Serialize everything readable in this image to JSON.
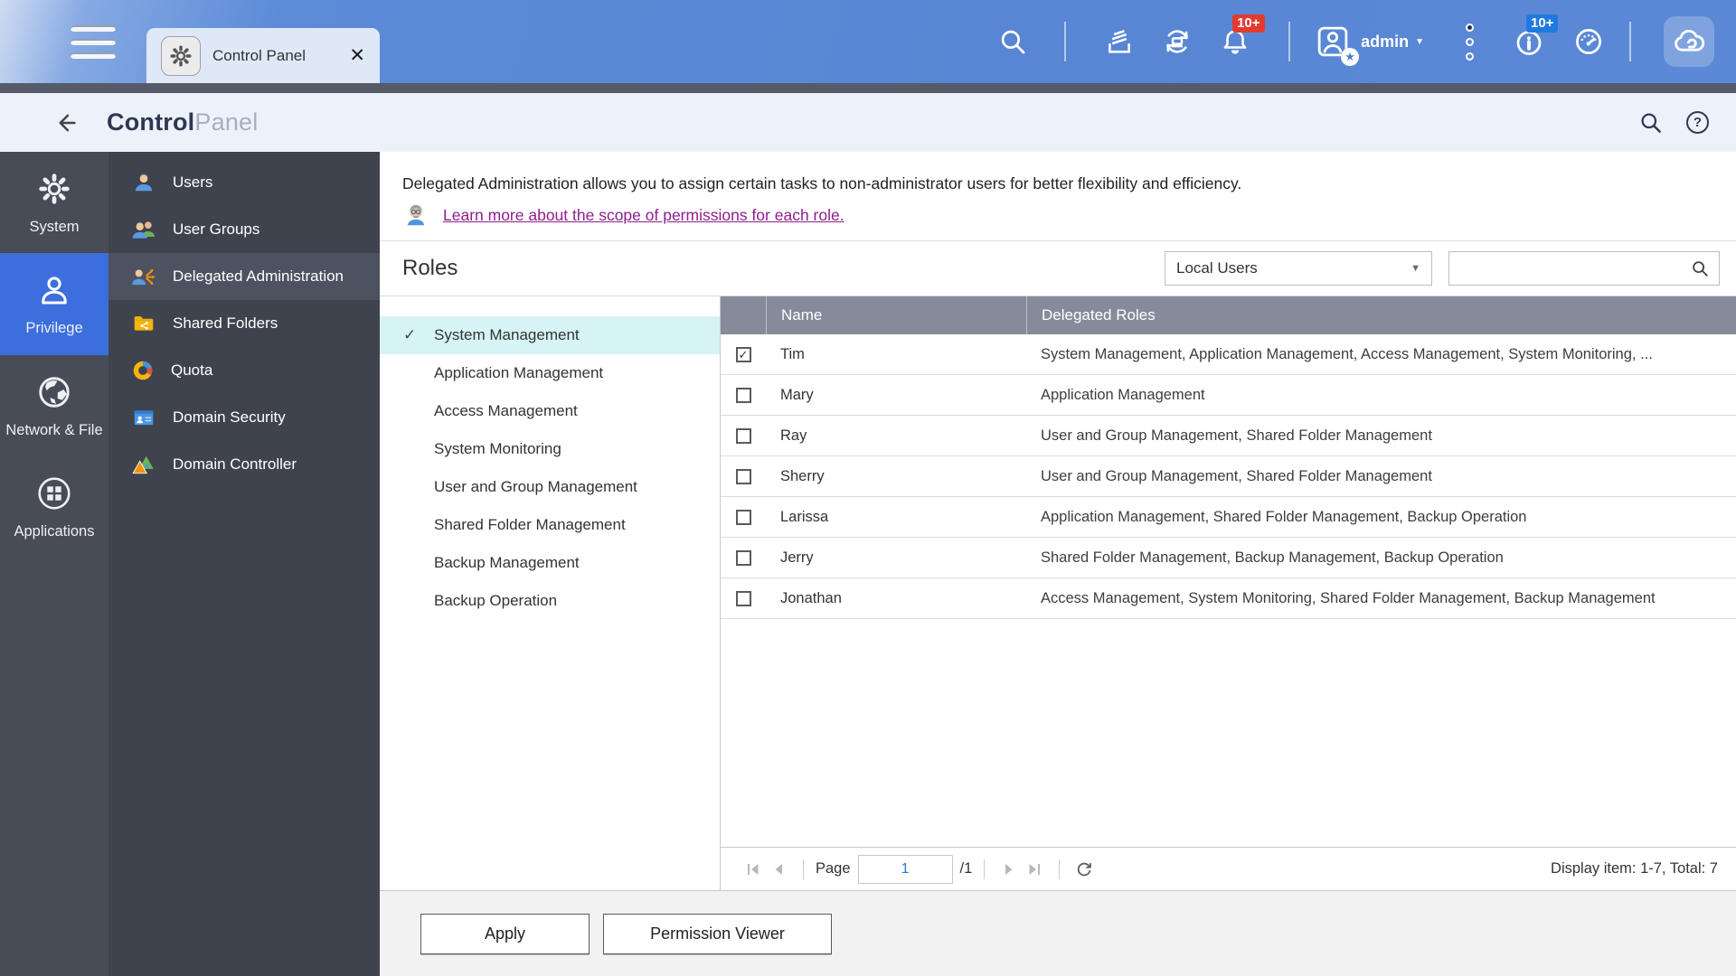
{
  "theme": {
    "accent": "#3c6edd",
    "badge-red": "#e23b2e",
    "badge-blue": "#1f7ae0",
    "link": "#8f1e8f",
    "selection": "#d6f3f5",
    "thead": "#858b9a"
  },
  "topbar": {
    "tab_label": "Control Panel",
    "close_label": "✕",
    "notification_badge": "10+",
    "event_badge": "10+",
    "user_name": "admin"
  },
  "header": {
    "title_bold": "Control",
    "title_light": "Panel",
    "help_glyph": "?"
  },
  "sidebar": {
    "active": "Privilege",
    "items": [
      {
        "label": "System"
      },
      {
        "label": "Privilege"
      },
      {
        "label": "Network & File"
      },
      {
        "label": "Applications"
      }
    ]
  },
  "subsidebar": {
    "active": "Delegated Administration",
    "items": [
      {
        "label": "Users"
      },
      {
        "label": "User Groups"
      },
      {
        "label": "Delegated Administration"
      },
      {
        "label": "Shared Folders"
      },
      {
        "label": "Quota"
      },
      {
        "label": "Domain Security"
      },
      {
        "label": "Domain Controller"
      }
    ]
  },
  "main": {
    "description": "Delegated Administration allows you to assign certain tasks to non-administrator users for better flexibility and efficiency.",
    "learn_more_link": "Learn more about the scope of permissions for each role.",
    "roles_title": "Roles",
    "filter_dropdown": {
      "selected": "Local Users"
    },
    "search": {
      "value": ""
    },
    "roles": {
      "selected": "System Management",
      "items": [
        {
          "label": "System Management",
          "selected": true
        },
        {
          "label": "Application Management",
          "selected": false
        },
        {
          "label": "Access Management",
          "selected": false
        },
        {
          "label": "System Monitoring",
          "selected": false
        },
        {
          "label": "User and Group Management",
          "selected": false
        },
        {
          "label": "Shared Folder Management",
          "selected": false
        },
        {
          "label": "Backup Management",
          "selected": false
        },
        {
          "label": "Backup Operation",
          "selected": false
        }
      ]
    },
    "table": {
      "columns": [
        "Name",
        "Delegated Roles"
      ],
      "rows": [
        {
          "name": "Tim",
          "roles": "System Management, Application Management, Access Management, System Monitoring, ...",
          "checked": true
        },
        {
          "name": "Mary",
          "roles": "Application Management",
          "checked": false
        },
        {
          "name": "Ray",
          "roles": "User and Group Management, Shared Folder Management",
          "checked": false
        },
        {
          "name": "Sherry",
          "roles": "User and Group Management, Shared Folder Management",
          "checked": false
        },
        {
          "name": "Larissa",
          "roles": "Application Management, Shared Folder Management, Backup Operation",
          "checked": false
        },
        {
          "name": "Jerry",
          "roles": "Shared Folder Management, Backup Management, Backup Operation",
          "checked": false
        },
        {
          "name": "Jonathan",
          "roles": "Access Management, System Monitoring, Shared Folder Management, Backup Management",
          "checked": false
        }
      ]
    },
    "pagination": {
      "page_label": "Page",
      "page_value": "1",
      "total_pages": "/1",
      "display_info": "Display item: 1-7, Total: 7"
    },
    "footer": {
      "apply_label": "Apply",
      "permission_viewer_label": "Permission Viewer"
    }
  }
}
